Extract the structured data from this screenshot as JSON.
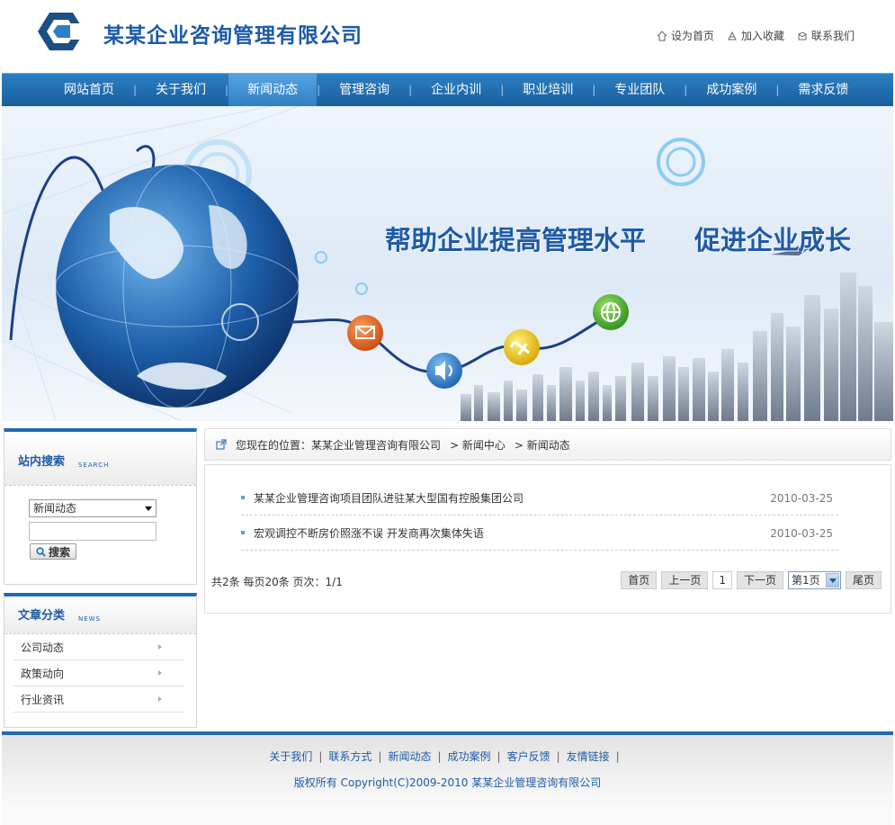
{
  "header": {
    "company_name": "某某企业咨询管理有限公司",
    "links": [
      {
        "label": "设为首页",
        "icon": "home-icon"
      },
      {
        "label": "加入收藏",
        "icon": "bookmark-icon"
      },
      {
        "label": "联系我们",
        "icon": "contact-icon"
      }
    ]
  },
  "nav": {
    "items": [
      "网站首页",
      "关于我们",
      "新闻动态",
      "管理咨询",
      "企业内训",
      "职业培训",
      "专业团队",
      "成功案例",
      "需求反馈"
    ],
    "active": "新闻动态"
  },
  "banner": {
    "slogan_1": "帮助企业提高管理水平",
    "slogan_2": "促进企业成长"
  },
  "search": {
    "title": "站内搜索",
    "title_en": "SEARCH",
    "selected": "新闻动态",
    "button": "搜索"
  },
  "categories": {
    "title": "文章分类",
    "title_en": "NEWS",
    "items": [
      "公司动态",
      "政策动向",
      "行业资讯"
    ]
  },
  "breadcrumb": {
    "prefix": "您现在的位置：",
    "items": [
      "某某企业管理咨询有限公司",
      "> 新闻中心",
      "> 新闻动态"
    ]
  },
  "news": [
    {
      "title": "某某企业管理咨询项目团队进驻某大型国有控股集团公司",
      "date": "2010-03-25"
    },
    {
      "title": "宏观调控不断房价照涨不误 开发商再次集体失语",
      "date": "2010-03-25"
    }
  ],
  "pager": {
    "info": "共2条  每页20条  页次：1/1",
    "first": "首页",
    "prev": "上一页",
    "current": "1",
    "next": "下一页",
    "select": "第1页",
    "last": "尾页"
  },
  "footer": {
    "links": [
      "关于我们",
      "联系方式",
      "新闻动态",
      "成功案例",
      "客户反馈",
      "友情链接"
    ],
    "copyright": "版权所有  Copyright(C)2009-2010 某某企业管理咨询有限公司"
  },
  "colors": {
    "brand": "#1f5aa6",
    "nav": "#1a5e9e",
    "nav_active": "#57a4e0"
  }
}
